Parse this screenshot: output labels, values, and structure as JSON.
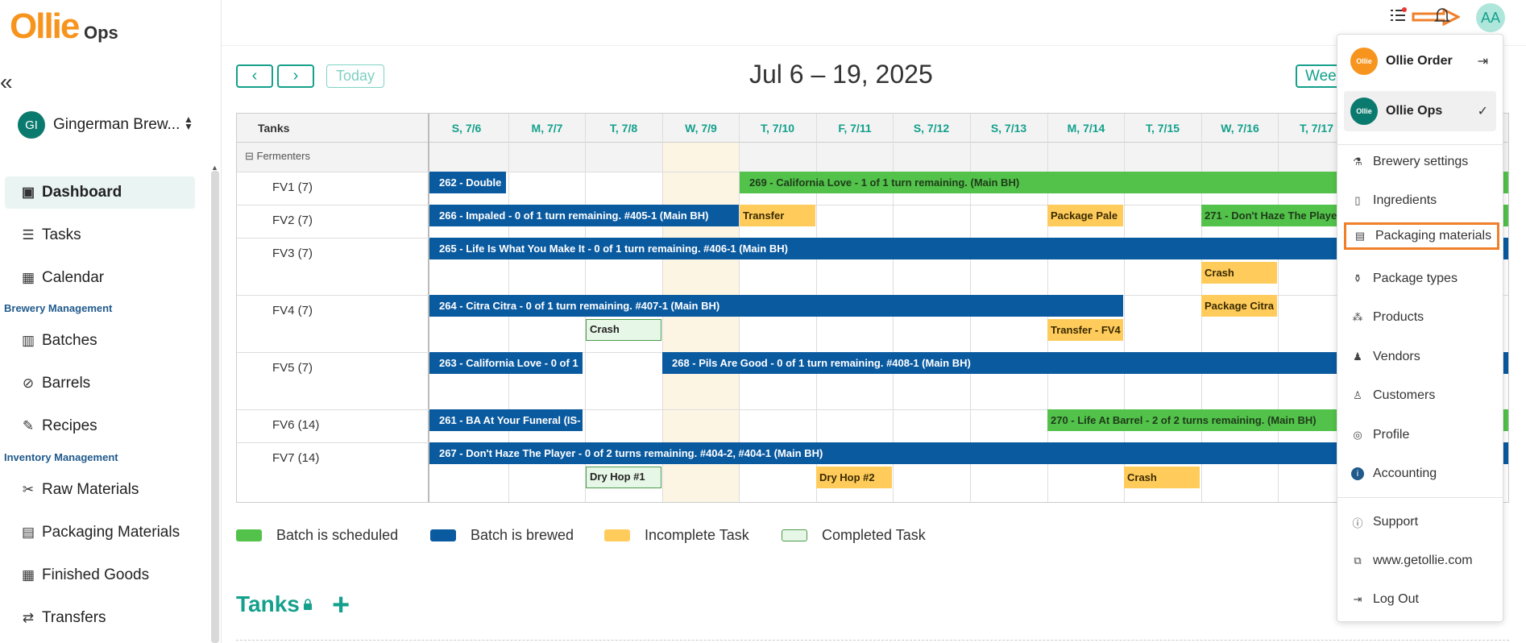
{
  "brand": {
    "logo": "Ollie",
    "product": "Ops"
  },
  "sidebar": {
    "collapse_icon": "«",
    "org": {
      "initials": "GI",
      "name": "Gingerman Brew..."
    },
    "items": [
      {
        "label": "Dashboard",
        "icon": "dashboard-icon"
      },
      {
        "label": "Tasks",
        "icon": "tasks-icon"
      },
      {
        "label": "Calendar",
        "icon": "calendar-icon"
      }
    ],
    "section_brewery": "Brewery Management",
    "brewery_items": [
      {
        "label": "Batches",
        "icon": "batches-icon"
      },
      {
        "label": "Barrels",
        "icon": "barrels-icon"
      },
      {
        "label": "Recipes",
        "icon": "recipes-icon"
      }
    ],
    "section_inventory": "Inventory Management",
    "inventory_items": [
      {
        "label": "Raw Materials",
        "icon": "raw-materials-icon"
      },
      {
        "label": "Packaging Materials",
        "icon": "packaging-icon"
      },
      {
        "label": "Finished Goods",
        "icon": "finished-goods-icon"
      },
      {
        "label": "Transfers",
        "icon": "transfers-icon"
      }
    ]
  },
  "toolbar": {
    "prev": "‹",
    "next": "›",
    "today": "Today",
    "range": "Jul 6 – 19, 2025",
    "view": "Week"
  },
  "calendar": {
    "tanks_header": "Tanks",
    "days": [
      "S, 7/6",
      "M, 7/7",
      "T, 7/8",
      "W, 7/9",
      "T, 7/10",
      "F, 7/11",
      "S, 7/12",
      "S, 7/13",
      "M, 7/14",
      "T, 7/15",
      "W, 7/16",
      "T, 7/17"
    ],
    "group": "Fermenters",
    "tanks": [
      "FV1 (7)",
      "FV2 (7)",
      "FV3 (7)",
      "FV4 (7)",
      "FV5 (7)",
      "FV6 (14)",
      "FV7 (14)"
    ],
    "bars": {
      "b262": "262 - Double",
      "b269": "269 - California Love - 1 of 1 turn remaining. (Main BH)",
      "b266": "266 - Impaled - 0 of 1 turn remaining. #405-1 (Main BH)",
      "transfer": "Transfer",
      "package_pale": "Package Pale",
      "b271": "271 - Don't Haze The Playe",
      "b265": "265 - Life Is What You Make It - 0 of 1 turn remaining. #406-1 (Main BH)",
      "crash_fv3": "Crash",
      "b264": "264 - Citra Citra - 0 of 1 turn remaining. #407-1 (Main BH)",
      "package_citra": "Package Citra",
      "crash_fv4": "Crash",
      "transfer_fv4": "Transfer - FV4",
      "b263": "263 - California Love - 0 of 1",
      "b268": "268 - Pils Are Good - 0 of 1 turn remaining. #408-1 (Main BH)",
      "b261": "261 - BA At Your Funeral (IS-",
      "b270": "270 - Life At Barrel - 2 of 2 turns remaining. (Main BH)",
      "b267": "267 - Don't Haze The Player - 0 of 2 turns remaining. #404-2, #404-1 (Main BH)",
      "dryhop1": "Dry Hop #1",
      "dryhop2": "Dry Hop #2",
      "crash_fv7": "Crash"
    }
  },
  "legend": {
    "scheduled": "Batch is scheduled",
    "brewed": "Batch is brewed",
    "incomplete": "Incomplete Task",
    "completed": "Completed Task"
  },
  "colors": {
    "scheduled": "#52c24a",
    "brewed": "#0a5aa0",
    "incomplete": "#ffcc5c",
    "completed": "#e7f7e7",
    "accent": "#14a08c",
    "highlight": "#f07f2a"
  },
  "tanks_section": {
    "title": "Tanks",
    "add": "+"
  },
  "user": {
    "initials": "AA"
  },
  "dropdown": {
    "apps": [
      {
        "name": "Ollie Order",
        "logo": "Ollie"
      },
      {
        "name": "Ollie Ops",
        "logo": "Ollie"
      }
    ],
    "items": [
      {
        "label": "Brewery settings",
        "icon": "brewery-settings-icon"
      },
      {
        "label": "Ingredients",
        "icon": "ingredients-icon"
      },
      {
        "label": "Packaging materials",
        "icon": "packaging-materials-icon"
      },
      {
        "label": "Package types",
        "icon": "package-types-icon"
      },
      {
        "label": "Products",
        "icon": "products-icon"
      },
      {
        "label": "Vendors",
        "icon": "vendors-icon"
      },
      {
        "label": "Customers",
        "icon": "customers-icon"
      },
      {
        "label": "Profile",
        "icon": "profile-icon"
      },
      {
        "label": "Accounting",
        "icon": "accounting-icon"
      }
    ],
    "links": [
      {
        "label": "Support",
        "icon": "support-icon"
      },
      {
        "label": "www.getollie.com",
        "icon": "external-link-icon"
      },
      {
        "label": "Log Out",
        "icon": "logout-icon"
      }
    ]
  }
}
